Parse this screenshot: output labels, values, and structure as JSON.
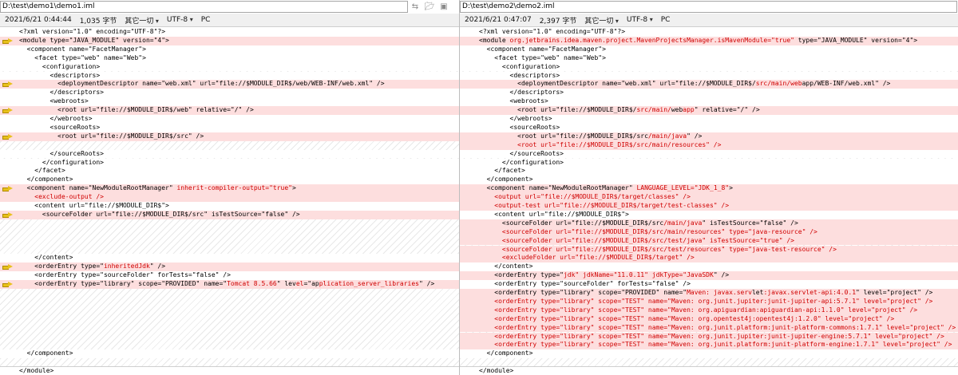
{
  "left": {
    "path": "D:\\test\\demo1\\demo1.iml",
    "info": {
      "date": "2021/6/21 0:44:44",
      "size": "1,035 字节",
      "other": "其它一切",
      "encoding": "UTF-8",
      "eol": "PC"
    },
    "lines": [
      {
        "parts": [
          {
            "t": "<?xml version=\"1.0\" encoding=\"UTF-8\"?>"
          }
        ]
      },
      {
        "diff": true,
        "arrow": true,
        "parts": [
          {
            "t": "<module type=\"JAVA_MODULE\" version=\"4\">"
          }
        ]
      },
      {
        "parts": [
          {
            "t": "  <component name=\"FacetManager\">"
          }
        ]
      },
      {
        "parts": [
          {
            "t": "    <facet type=\"web\" name=\"Web\">"
          }
        ]
      },
      {
        "parts": [
          {
            "t": "      <configuration>"
          }
        ]
      },
      {
        "parts": [
          {
            "t": "        <descriptors>"
          }
        ]
      },
      {
        "diff": true,
        "arrow": true,
        "parts": [
          {
            "t": "          <deploymentDescriptor name=\"web.xml\" url=\"file://$MODULE_DIR$/web/WEB-INF/web.xml\" />"
          }
        ]
      },
      {
        "parts": [
          {
            "t": "        </descriptors>"
          }
        ]
      },
      {
        "parts": [
          {
            "t": "        <webroots>"
          }
        ]
      },
      {
        "diff": true,
        "arrow": true,
        "parts": [
          {
            "t": "          <root url=\"file://$MODULE_DIR$/web\" relative=\"/\" />"
          }
        ]
      },
      {
        "parts": [
          {
            "t": "        </webroots>"
          }
        ]
      },
      {
        "parts": [
          {
            "t": "        <sourceRoots>"
          }
        ]
      },
      {
        "diff": true,
        "arrow": true,
        "parts": [
          {
            "t": "          <root url=\"file://$MODULE_DIR$/src\" />"
          }
        ]
      },
      {
        "pad": true
      },
      {
        "parts": [
          {
            "t": "        </sourceRoots>"
          }
        ]
      },
      {
        "parts": [
          {
            "t": "      </configuration>"
          }
        ]
      },
      {
        "parts": [
          {
            "t": "    </facet>"
          }
        ]
      },
      {
        "parts": [
          {
            "t": "  </component>"
          }
        ]
      },
      {
        "diff": true,
        "arrow": true,
        "parts": [
          {
            "t": "  <component name=\"NewModuleRootManager\" "
          },
          {
            "t": "inherit-compiler-output=\"true\"",
            "hl": true
          },
          {
            "t": ">"
          }
        ]
      },
      {
        "diff": true,
        "parts": [
          {
            "t": "    "
          },
          {
            "t": "<exclude-output />",
            "hl": true
          }
        ]
      },
      {
        "parts": [
          {
            "t": "    <content url=\"file://$MODULE_DIR$\">"
          }
        ]
      },
      {
        "diff": true,
        "arrow": true,
        "parts": [
          {
            "t": "      <sourceFolder url=\"file://$MODULE_DIR$/src\" isTestSource=\"false\" />"
          }
        ]
      },
      {
        "pad": true
      },
      {
        "pad": true
      },
      {
        "pad": true
      },
      {
        "pad": true
      },
      {
        "parts": [
          {
            "t": "    </content>"
          }
        ]
      },
      {
        "diff": true,
        "arrow": true,
        "parts": [
          {
            "t": "    <orderEntry type=\""
          },
          {
            "t": "inheritedJdk",
            "hl": true
          },
          {
            "t": "\" />"
          }
        ]
      },
      {
        "parts": [
          {
            "t": "    <orderEntry type=\"sourceFolder\" forTests=\"false\" />"
          }
        ]
      },
      {
        "diff": true,
        "arrow": true,
        "parts": [
          {
            "t": "    <orderEntry type=\"library\" scope=\"PROVIDED\" name=\""
          },
          {
            "t": "Tomcat 8.5.66",
            "hl": true
          },
          {
            "t": "\" lev"
          },
          {
            "t": "el",
            "hl": true
          },
          {
            "t": "=\"ap"
          },
          {
            "t": "plication_server_libraries",
            "hl": true
          },
          {
            "t": "\" />"
          }
        ]
      },
      {
        "pad": true
      },
      {
        "pad": true
      },
      {
        "pad": true
      },
      {
        "pad": true
      },
      {
        "pad": true
      },
      {
        "pad": true
      },
      {
        "pad": true
      },
      {
        "parts": [
          {
            "t": "  </component>"
          }
        ]
      }
    ],
    "last": "</module>"
  },
  "right": {
    "path": "D:\\test\\demo2\\demo2.iml",
    "info": {
      "date": "2021/6/21 0:47:07",
      "size": "2,397 字节",
      "other": "其它一切",
      "encoding": "UTF-8",
      "eol": "PC"
    },
    "lines": [
      {
        "parts": [
          {
            "t": "<?xml version=\"1.0\" encoding=\"UTF-8\"?>"
          }
        ]
      },
      {
        "diff": true,
        "parts": [
          {
            "t": "<module "
          },
          {
            "t": "org.jetbrains.idea.maven.project.MavenProjectsManager.isMavenModule=\"true\"",
            "hl": true
          },
          {
            "t": " type=\"JAVA_MODULE\" version=\"4\">"
          }
        ]
      },
      {
        "parts": [
          {
            "t": "  <component name=\"FacetManager\">"
          }
        ]
      },
      {
        "parts": [
          {
            "t": "    <facet type=\"web\" name=\"Web\">"
          }
        ]
      },
      {
        "parts": [
          {
            "t": "      <configuration>"
          }
        ]
      },
      {
        "parts": [
          {
            "t": "        <descriptors>"
          }
        ]
      },
      {
        "diff": true,
        "parts": [
          {
            "t": "          <deploymentDescriptor name=\"web.xml\" url=\"file://$MODULE_DIR$/"
          },
          {
            "t": "src/main/web",
            "hl": true
          },
          {
            "t": "app/WEB-INF/web.xml\" />"
          }
        ]
      },
      {
        "parts": [
          {
            "t": "        </descriptors>"
          }
        ]
      },
      {
        "parts": [
          {
            "t": "        <webroots>"
          }
        ]
      },
      {
        "diff": true,
        "parts": [
          {
            "t": "          <root url=\"file://$MODULE_DIR$/"
          },
          {
            "t": "src/main/",
            "hl": true
          },
          {
            "t": "web"
          },
          {
            "t": "app",
            "hl": true
          },
          {
            "t": "\" relative=\"/\" />"
          }
        ]
      },
      {
        "parts": [
          {
            "t": "        </webroots>"
          }
        ]
      },
      {
        "parts": [
          {
            "t": "        <sourceRoots>"
          }
        ]
      },
      {
        "diff": true,
        "parts": [
          {
            "t": "          <root url=\"file://$MODULE_DIR$/src"
          },
          {
            "t": "/main/java",
            "hl": true
          },
          {
            "t": "\" />"
          }
        ]
      },
      {
        "diff": true,
        "parts": [
          {
            "t": "          "
          },
          {
            "t": "<root url=\"file://$MODULE_DIR$/src/main/resources\" />",
            "hl": true
          }
        ]
      },
      {
        "parts": [
          {
            "t": "        </sourceRoots>"
          }
        ]
      },
      {
        "parts": [
          {
            "t": "      </configuration>"
          }
        ]
      },
      {
        "parts": [
          {
            "t": "    </facet>"
          }
        ]
      },
      {
        "parts": [
          {
            "t": "  </component>"
          }
        ]
      },
      {
        "diff": true,
        "parts": [
          {
            "t": "  <component name=\"NewModuleRootManager\" "
          },
          {
            "t": "LANGUAGE_LEVEL=\"JDK_1_8\"",
            "hl": true
          },
          {
            "t": ">"
          }
        ]
      },
      {
        "diff": true,
        "parts": [
          {
            "t": "    "
          },
          {
            "t": "<output url=\"file://$MODULE_DIR$/target/classes\" />",
            "hl": true
          }
        ]
      },
      {
        "diff": true,
        "parts": [
          {
            "t": "    "
          },
          {
            "t": "<output-test url=\"file://$MODULE_DIR$/target/test-classes\" />",
            "hl": true
          }
        ]
      },
      {
        "parts": [
          {
            "t": "    <content url=\"file://$MODULE_DIR$\">"
          }
        ]
      },
      {
        "diff": true,
        "parts": [
          {
            "t": "      <sourceFolder url=\"file://$MODULE_DIR$/src"
          },
          {
            "t": "/main/java",
            "hl": true
          },
          {
            "t": "\" isTestSource=\"false\" />"
          }
        ]
      },
      {
        "diff": true,
        "parts": [
          {
            "t": "      "
          },
          {
            "t": "<sourceFolder url=\"file://$MODULE_DIR$/src/main/resources\" type=\"java-resource\" />",
            "hl": true
          }
        ]
      },
      {
        "diff": true,
        "parts": [
          {
            "t": "      "
          },
          {
            "t": "<sourceFolder url=\"file://$MODULE_DIR$/src/test/java\" isTestSource=\"true\" />",
            "hl": true
          }
        ]
      },
      {
        "diff": true,
        "parts": [
          {
            "t": "      "
          },
          {
            "t": "<sourceFolder url=\"file://$MODULE_DIR$/src/test/resources\" type=\"java-test-resource\" />",
            "hl": true
          }
        ]
      },
      {
        "diff": true,
        "parts": [
          {
            "t": "      "
          },
          {
            "t": "<excludeFolder url=\"file://$MODULE_DIR$/target\" />",
            "hl": true
          }
        ]
      },
      {
        "parts": [
          {
            "t": "    </content>"
          }
        ]
      },
      {
        "diff": true,
        "parts": [
          {
            "t": "    <orderEntry type=\""
          },
          {
            "t": "jdk\" jdkName=\"11.0.11\" jdkType=\"JavaSDK",
            "hl": true
          },
          {
            "t": "\" />"
          }
        ]
      },
      {
        "parts": [
          {
            "t": "    <orderEntry type=\"sourceFolder\" forTests=\"false\" />"
          }
        ]
      },
      {
        "diff": true,
        "parts": [
          {
            "t": "    <orderEntry type=\"library\" scope=\"PROVIDED\" name=\""
          },
          {
            "t": "Maven: javax.serv",
            "hl": true
          },
          {
            "t": "let"
          },
          {
            "t": ":javax.servlet-api:4.0.1",
            "hl": true
          },
          {
            "t": "\" level=\"project\" />"
          }
        ]
      },
      {
        "diff": true,
        "parts": [
          {
            "t": "    "
          },
          {
            "t": "<orderEntry type=\"library\" scope=\"TEST\" name=\"Maven: org.junit.jupiter:junit-jupiter-api:5.7.1\" level=\"project\" />",
            "hl": true
          }
        ]
      },
      {
        "diff": true,
        "parts": [
          {
            "t": "    "
          },
          {
            "t": "<orderEntry type=\"library\" scope=\"TEST\" name=\"Maven: org.apiguardian:apiguardian-api:1.1.0\" level=\"project\" />",
            "hl": true
          }
        ]
      },
      {
        "diff": true,
        "parts": [
          {
            "t": "    "
          },
          {
            "t": "<orderEntry type=\"library\" scope=\"TEST\" name=\"Maven: org.opentest4j:opentest4j:1.2.0\" level=\"project\" />",
            "hl": true
          }
        ]
      },
      {
        "diff": true,
        "parts": [
          {
            "t": "    "
          },
          {
            "t": "<orderEntry type=\"library\" scope=\"TEST\" name=\"Maven: org.junit.platform:junit-platform-commons:1.7.1\" level=\"project\" />",
            "hl": true
          }
        ]
      },
      {
        "diff": true,
        "parts": [
          {
            "t": "    "
          },
          {
            "t": "<orderEntry type=\"library\" scope=\"TEST\" name=\"Maven: org.junit.jupiter:junit-jupiter-engine:5.7.1\" level=\"project\" />",
            "hl": true
          }
        ]
      },
      {
        "diff": true,
        "parts": [
          {
            "t": "    "
          },
          {
            "t": "<orderEntry type=\"library\" scope=\"TEST\" name=\"Maven: org.junit.platform:junit-platform-engine:1.7.1\" level=\"project\" />",
            "hl": true
          }
        ]
      },
      {
        "parts": [
          {
            "t": "  </component>"
          }
        ]
      }
    ],
    "last": "</module>"
  },
  "icons": {
    "swap": "swap-arrows-icon",
    "open": "folder-open-icon",
    "save": "save-icon"
  }
}
